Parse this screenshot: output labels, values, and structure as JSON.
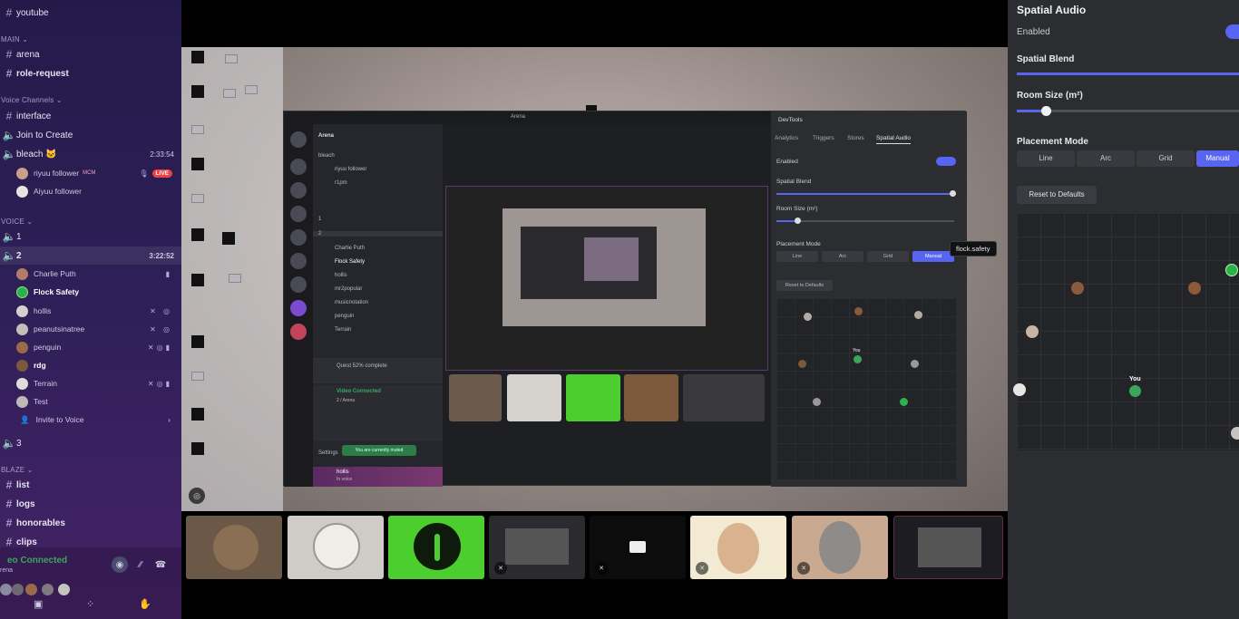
{
  "sidebar": {
    "top_channel": "youtube",
    "categories": {
      "main": "MAIN",
      "voice_channels": "Voice Channels",
      "voice": "VOICE",
      "blaze": "BLAZE"
    },
    "main_channels": [
      "arena",
      "role-request"
    ],
    "voice_channels": {
      "interface": "interface",
      "join_to_create": "Join to Create",
      "bleach": "bleach 🐱",
      "bleach_timer": "2:33:54",
      "bleach_users": [
        {
          "name": "riyuu follower",
          "tag": "MCM",
          "live": "LIVE"
        },
        {
          "name": "Aiyuu follower"
        }
      ]
    },
    "voice": {
      "channel_1": "1",
      "channel_2": "2",
      "channel_2_timer": "3:22:52",
      "users": [
        "Charlie Puth",
        "Flock Safety",
        "hollis",
        "peanutsinatree",
        "penguin",
        "rdg",
        "Terrain",
        "Test"
      ],
      "invite": "Invite to Voice",
      "channel_3": "3"
    },
    "blaze_channels": [
      "list",
      "logs",
      "honorables",
      "clips"
    ],
    "voice_panel": {
      "status": "eo Connected",
      "sub": "rena"
    }
  },
  "inner_window": {
    "title": "Arena",
    "server_name": "Arena",
    "channels": [
      "bleach",
      "riyuu follower",
      "r1pm",
      "1",
      "2",
      "Charlie Puth",
      "Flock Safety",
      "hollis",
      "mr2popular",
      "musicnotation",
      "penguin",
      "Terrain"
    ],
    "quest": "Quest 52% complete",
    "video_connected": "Video Connected",
    "video_sub": "2 / Arena",
    "settings": "Settings",
    "toast": "You are currently muted",
    "user": "hollis",
    "user_sub": "In voice",
    "devtools": {
      "title": "DevTools",
      "tabs": [
        "Analytics",
        "Triggers",
        "Stores",
        "Spatial Audio"
      ],
      "enabled": "Enabled",
      "spatial_blend": "Spatial Blend",
      "room_size": "Room Size (m²)",
      "placement_mode": "Placement Mode",
      "modes": [
        "Line",
        "Arc",
        "Grid",
        "Manual"
      ],
      "reset": "Reset to Defaults",
      "you": "You"
    }
  },
  "tooltip": "flock.safety",
  "right_panel": {
    "title": "Spatial Audio",
    "enabled_label": "Enabled",
    "enabled": true,
    "spatial_blend_label": "Spatial Blend",
    "spatial_blend_value": 1.0,
    "room_size_label": "Room Size (m²)",
    "room_size_value": 0.13,
    "placement_mode_label": "Placement Mode",
    "modes": [
      "Line",
      "Arc",
      "Grid",
      "Manual"
    ],
    "selected_mode": "Manual",
    "reset_label": "Reset to Defaults",
    "you_label": "You"
  },
  "colors": {
    "accent": "#5865f2",
    "connected": "#3ba55d",
    "live": "#ed4245",
    "flock_green": "#4ccf2e"
  }
}
